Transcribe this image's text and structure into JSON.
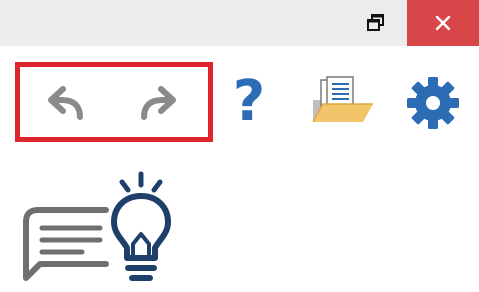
{
  "window": {
    "restore_icon": "restore-window-icon",
    "close_icon": "close-icon",
    "close_color": "#d9464a"
  },
  "toolbar": {
    "undo_icon": "undo-arrow-icon",
    "redo_icon": "redo-arrow-icon",
    "help_label": "?",
    "open_icon": "open-folder-document-icon",
    "settings_icon": "gear-icon",
    "accent_color": "#2b6cb5",
    "highlight_color": "#e0242d"
  },
  "feature_icon": "chat-bubble-lightbulb-icon"
}
